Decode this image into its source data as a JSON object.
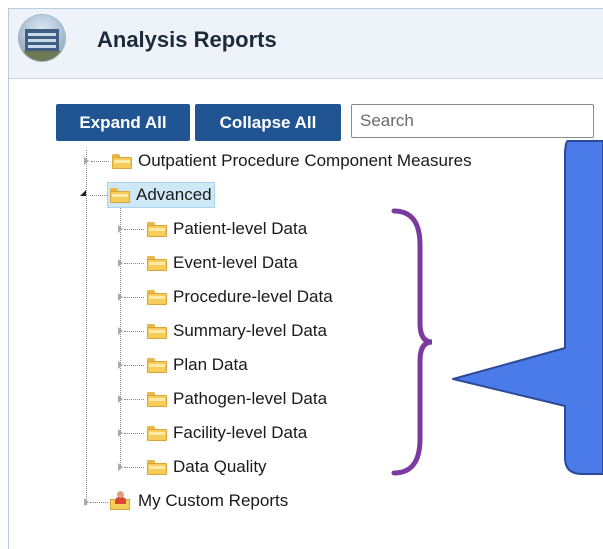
{
  "header": {
    "title": "Analysis Reports",
    "logo_icon": "building-photo-icon"
  },
  "toolbar": {
    "expand_label": "Expand All",
    "collapse_label": "Collapse All",
    "search_placeholder": "Search",
    "search_value": ""
  },
  "tree": {
    "outpatient": "Outpatient Procedure Component Measures",
    "advanced": "Advanced",
    "children": [
      "Patient-level Data",
      "Event-level Data",
      "Procedure-level Data",
      "Summary-level Data",
      "Plan Data",
      "Pathogen-level Data",
      "Facility-level Data",
      "Data Quality"
    ],
    "custom": "My Custom Reports"
  },
  "colors": {
    "button": "#205493",
    "callout": "#4a7be8",
    "brace": "#7a3aa0",
    "selected": "#cfe8f6"
  }
}
